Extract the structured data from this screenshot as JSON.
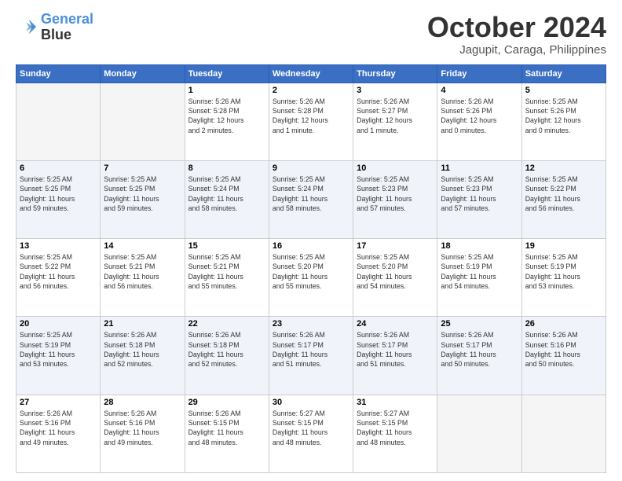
{
  "logo": {
    "line1": "General",
    "line2": "Blue"
  },
  "title": "October 2024",
  "subtitle": "Jagupit, Caraga, Philippines",
  "headers": [
    "Sunday",
    "Monday",
    "Tuesday",
    "Wednesday",
    "Thursday",
    "Friday",
    "Saturday"
  ],
  "weeks": [
    [
      {
        "day": "",
        "info": ""
      },
      {
        "day": "",
        "info": ""
      },
      {
        "day": "1",
        "info": "Sunrise: 5:26 AM\nSunset: 5:28 PM\nDaylight: 12 hours\nand 2 minutes."
      },
      {
        "day": "2",
        "info": "Sunrise: 5:26 AM\nSunset: 5:28 PM\nDaylight: 12 hours\nand 1 minute."
      },
      {
        "day": "3",
        "info": "Sunrise: 5:26 AM\nSunset: 5:27 PM\nDaylight: 12 hours\nand 1 minute."
      },
      {
        "day": "4",
        "info": "Sunrise: 5:26 AM\nSunset: 5:26 PM\nDaylight: 12 hours\nand 0 minutes."
      },
      {
        "day": "5",
        "info": "Sunrise: 5:25 AM\nSunset: 5:26 PM\nDaylight: 12 hours\nand 0 minutes."
      }
    ],
    [
      {
        "day": "6",
        "info": "Sunrise: 5:25 AM\nSunset: 5:25 PM\nDaylight: 11 hours\nand 59 minutes."
      },
      {
        "day": "7",
        "info": "Sunrise: 5:25 AM\nSunset: 5:25 PM\nDaylight: 11 hours\nand 59 minutes."
      },
      {
        "day": "8",
        "info": "Sunrise: 5:25 AM\nSunset: 5:24 PM\nDaylight: 11 hours\nand 58 minutes."
      },
      {
        "day": "9",
        "info": "Sunrise: 5:25 AM\nSunset: 5:24 PM\nDaylight: 11 hours\nand 58 minutes."
      },
      {
        "day": "10",
        "info": "Sunrise: 5:25 AM\nSunset: 5:23 PM\nDaylight: 11 hours\nand 57 minutes."
      },
      {
        "day": "11",
        "info": "Sunrise: 5:25 AM\nSunset: 5:23 PM\nDaylight: 11 hours\nand 57 minutes."
      },
      {
        "day": "12",
        "info": "Sunrise: 5:25 AM\nSunset: 5:22 PM\nDaylight: 11 hours\nand 56 minutes."
      }
    ],
    [
      {
        "day": "13",
        "info": "Sunrise: 5:25 AM\nSunset: 5:22 PM\nDaylight: 11 hours\nand 56 minutes."
      },
      {
        "day": "14",
        "info": "Sunrise: 5:25 AM\nSunset: 5:21 PM\nDaylight: 11 hours\nand 56 minutes."
      },
      {
        "day": "15",
        "info": "Sunrise: 5:25 AM\nSunset: 5:21 PM\nDaylight: 11 hours\nand 55 minutes."
      },
      {
        "day": "16",
        "info": "Sunrise: 5:25 AM\nSunset: 5:20 PM\nDaylight: 11 hours\nand 55 minutes."
      },
      {
        "day": "17",
        "info": "Sunrise: 5:25 AM\nSunset: 5:20 PM\nDaylight: 11 hours\nand 54 minutes."
      },
      {
        "day": "18",
        "info": "Sunrise: 5:25 AM\nSunset: 5:19 PM\nDaylight: 11 hours\nand 54 minutes."
      },
      {
        "day": "19",
        "info": "Sunrise: 5:25 AM\nSunset: 5:19 PM\nDaylight: 11 hours\nand 53 minutes."
      }
    ],
    [
      {
        "day": "20",
        "info": "Sunrise: 5:25 AM\nSunset: 5:19 PM\nDaylight: 11 hours\nand 53 minutes."
      },
      {
        "day": "21",
        "info": "Sunrise: 5:26 AM\nSunset: 5:18 PM\nDaylight: 11 hours\nand 52 minutes."
      },
      {
        "day": "22",
        "info": "Sunrise: 5:26 AM\nSunset: 5:18 PM\nDaylight: 11 hours\nand 52 minutes."
      },
      {
        "day": "23",
        "info": "Sunrise: 5:26 AM\nSunset: 5:17 PM\nDaylight: 11 hours\nand 51 minutes."
      },
      {
        "day": "24",
        "info": "Sunrise: 5:26 AM\nSunset: 5:17 PM\nDaylight: 11 hours\nand 51 minutes."
      },
      {
        "day": "25",
        "info": "Sunrise: 5:26 AM\nSunset: 5:17 PM\nDaylight: 11 hours\nand 50 minutes."
      },
      {
        "day": "26",
        "info": "Sunrise: 5:26 AM\nSunset: 5:16 PM\nDaylight: 11 hours\nand 50 minutes."
      }
    ],
    [
      {
        "day": "27",
        "info": "Sunrise: 5:26 AM\nSunset: 5:16 PM\nDaylight: 11 hours\nand 49 minutes."
      },
      {
        "day": "28",
        "info": "Sunrise: 5:26 AM\nSunset: 5:16 PM\nDaylight: 11 hours\nand 49 minutes."
      },
      {
        "day": "29",
        "info": "Sunrise: 5:26 AM\nSunset: 5:15 PM\nDaylight: 11 hours\nand 48 minutes."
      },
      {
        "day": "30",
        "info": "Sunrise: 5:27 AM\nSunset: 5:15 PM\nDaylight: 11 hours\nand 48 minutes."
      },
      {
        "day": "31",
        "info": "Sunrise: 5:27 AM\nSunset: 5:15 PM\nDaylight: 11 hours\nand 48 minutes."
      },
      {
        "day": "",
        "info": ""
      },
      {
        "day": "",
        "info": ""
      }
    ]
  ]
}
